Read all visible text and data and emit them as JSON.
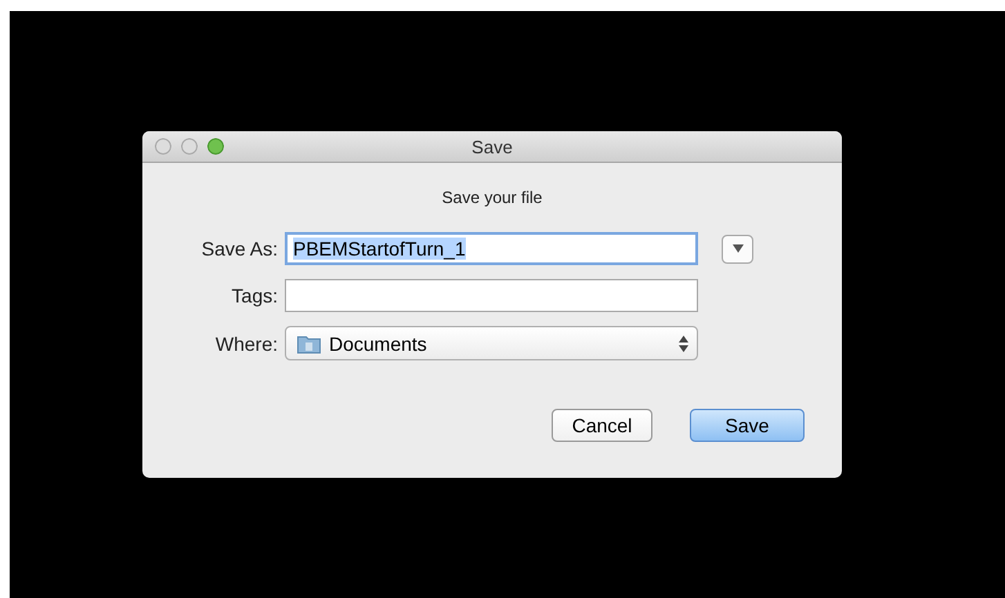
{
  "window": {
    "title": "Save"
  },
  "message": "Save your file",
  "fields": [
    {
      "kind": "text",
      "label": "Save As:",
      "value": "PBEMStartofTurn_1",
      "selected": true
    },
    {
      "kind": "text",
      "label": "Tags:",
      "selected": false
    },
    {
      "kind": "popup",
      "label": "Where:",
      "value": "Documents"
    }
  ],
  "buttons": [
    {
      "label": "Cancel",
      "default": false
    },
    {
      "label": "Save",
      "default": true
    }
  ]
}
